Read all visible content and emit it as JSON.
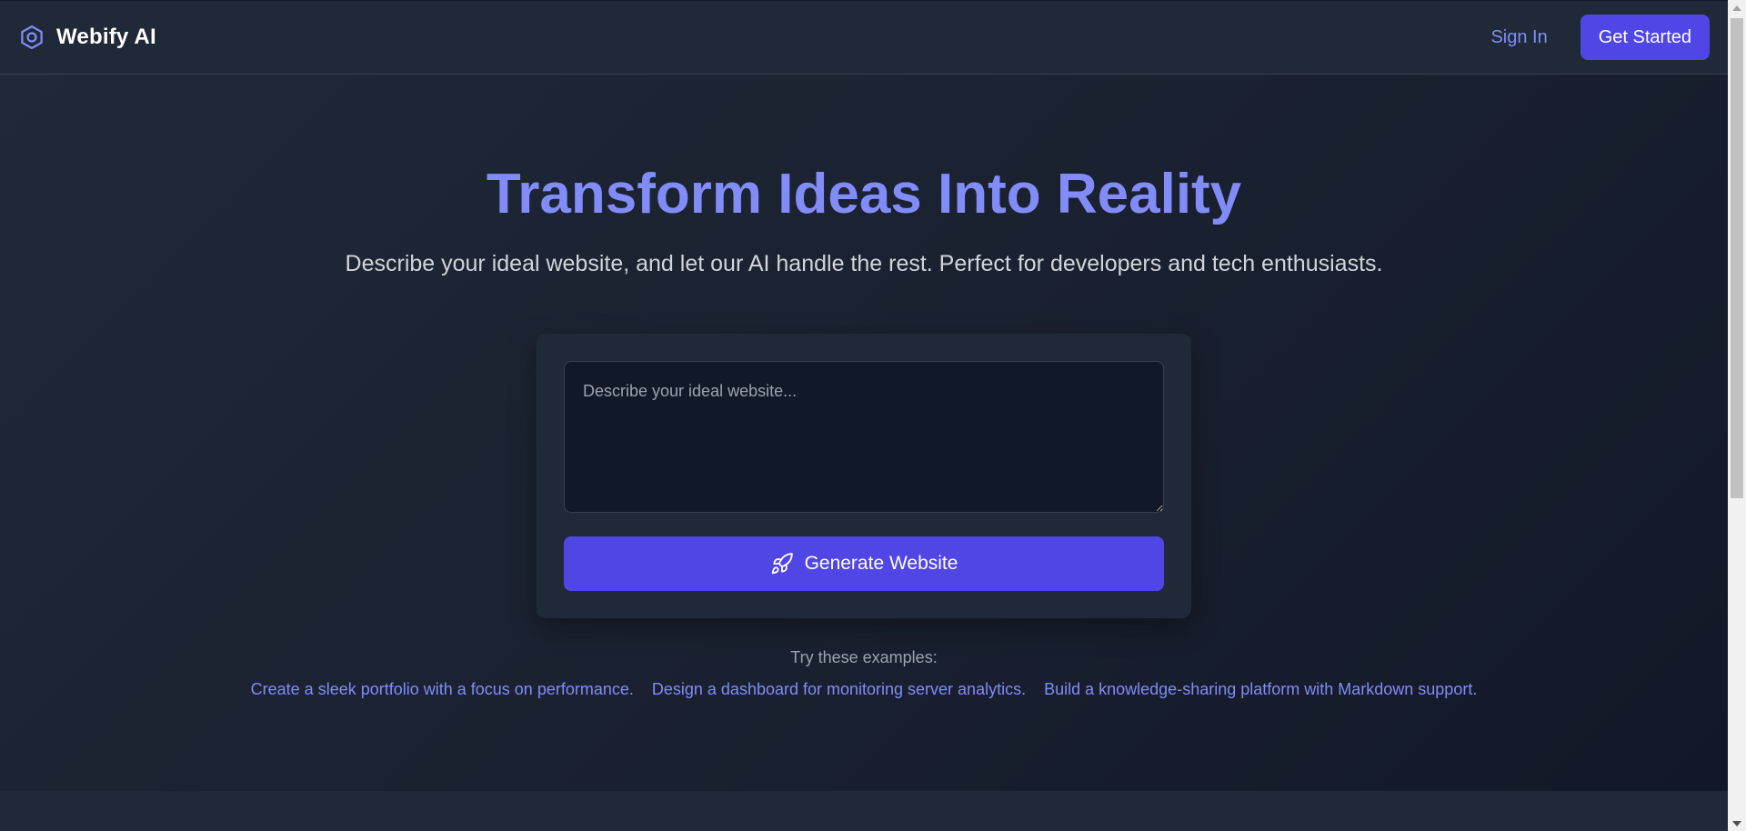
{
  "header": {
    "brand_name": "Webify AI",
    "brand_icon": "hexagon-icon",
    "sign_in_label": "Sign In",
    "get_started_label": "Get Started"
  },
  "hero": {
    "title": "Transform Ideas Into Reality",
    "subtitle": "Describe your ideal website, and let our AI handle the rest. Perfect for developers and tech enthusiasts."
  },
  "generator": {
    "prompt_placeholder": "Describe your ideal website...",
    "prompt_value": "",
    "generate_label": "Generate Website",
    "generate_icon": "rocket-icon"
  },
  "examples": {
    "label": "Try these examples:",
    "items": [
      "Create a sleek portfolio with a focus on performance.",
      "Design a dashboard for monitoring server analytics.",
      "Build a knowledge-sharing platform with Markdown support."
    ]
  },
  "colors": {
    "accent": "#4f46e5",
    "accent_light": "#818cf8",
    "background": "#1f2937",
    "input_background": "#111827"
  }
}
